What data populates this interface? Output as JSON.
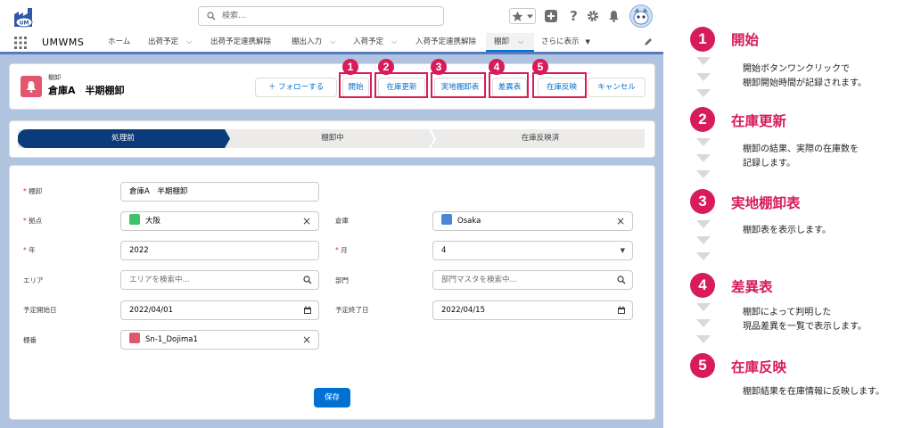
{
  "header": {
    "search_placeholder": "検索..."
  },
  "nav": {
    "app_name": "UMWMS",
    "items": [
      {
        "label": "ホーム",
        "dropdown": false
      },
      {
        "label": "出荷予定",
        "dropdown": true
      },
      {
        "label": "出荷予定連携解除",
        "dropdown": false
      },
      {
        "label": "棚出入力",
        "dropdown": true
      },
      {
        "label": "入荷予定",
        "dropdown": true
      },
      {
        "label": "入荷予定連携解除",
        "dropdown": false
      },
      {
        "label": "棚卸",
        "dropdown": true,
        "active": true
      },
      {
        "label": "さらに表示",
        "dropdown": true
      }
    ]
  },
  "record": {
    "object_label": "棚卸",
    "title": "倉庫A　半期棚卸",
    "buttons": {
      "follow": "＋ フォローする",
      "start": "開始",
      "update_stock": "在庫更新",
      "count_sheet": "実地棚卸表",
      "diff_sheet": "差異表",
      "reflect": "在庫反映",
      "cancel": "キャンセル"
    },
    "badges": [
      "1",
      "2",
      "3",
      "4",
      "5"
    ]
  },
  "path": {
    "stages": [
      "処理前",
      "棚卸中",
      "在庫反映済"
    ],
    "current": 0
  },
  "form": {
    "tanaoroshi": {
      "label": "棚卸",
      "value": "倉庫A　半期棚卸",
      "required": true
    },
    "kyoten": {
      "label": "拠点",
      "value": "大阪",
      "required": true
    },
    "souko": {
      "label": "倉庫",
      "value": "Osaka"
    },
    "year": {
      "label": "年",
      "value": "2022",
      "required": true
    },
    "month": {
      "label": "月",
      "value": "4",
      "required": true
    },
    "area": {
      "label": "エリア",
      "placeholder": "エリアを検索中..."
    },
    "bumon": {
      "label": "部門",
      "placeholder": "部門マスタを検索中..."
    },
    "start_date": {
      "label": "予定開始日",
      "value": "2022/04/01"
    },
    "end_date": {
      "label": "予定終了日",
      "value": "2022/04/15"
    },
    "tanaban": {
      "label": "棚番",
      "value": "Sn-1_Dojima1"
    },
    "save": "保存"
  },
  "steps": [
    {
      "num": "1",
      "title": "開始",
      "desc": [
        "開始ボタンワンクリックで",
        "棚卸開始時間が記録されます。"
      ]
    },
    {
      "num": "2",
      "title": "在庫更新",
      "desc": [
        "棚卸の結果、実際の在庫数を",
        "記録します。"
      ]
    },
    {
      "num": "3",
      "title": "実地棚卸表",
      "desc": [
        "棚卸表を表示します。"
      ]
    },
    {
      "num": "4",
      "title": "差異表",
      "desc": [
        "棚卸によって判明した",
        "現品差異を一覧で表示します。"
      ]
    },
    {
      "num": "5",
      "title": "在庫反映",
      "desc": [
        "棚卸結果を在庫情報に反映します。"
      ]
    }
  ],
  "colors": {
    "accent": "#d81b5a",
    "brand": "#0070d2",
    "path_active": "#0b3b7a",
    "record_icon": "#e3566d"
  }
}
